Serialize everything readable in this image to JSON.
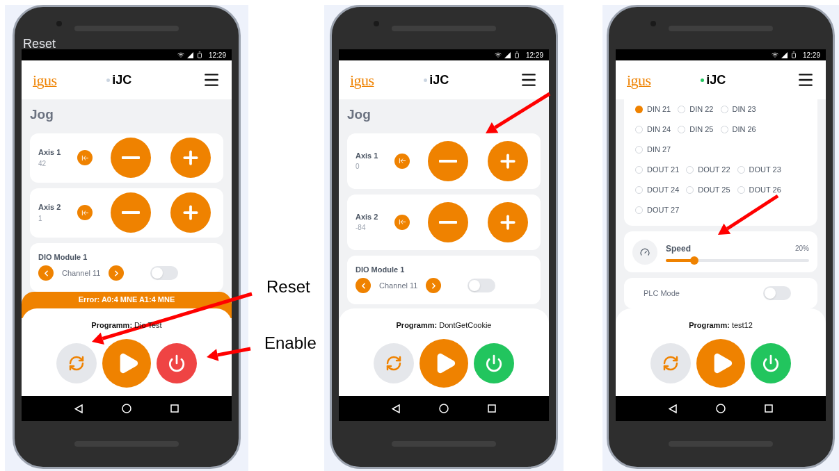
{
  "overlay_text": "Reset",
  "annotations": [
    {
      "text": "Reset"
    },
    {
      "text": "Enable"
    }
  ],
  "phones": [
    {
      "time": "12:29",
      "logo": "igus",
      "app_title": "iJC",
      "connected": false,
      "page_title": "Jog",
      "cards": [
        {
          "kind": "axis",
          "label": "Axis 1",
          "value": "42"
        },
        {
          "kind": "axis",
          "label": "Axis 2",
          "value": "1"
        },
        {
          "kind": "dio",
          "label": "DIO Module 1",
          "channel": "Channel 11",
          "on": false
        }
      ],
      "error": "Error: A0:4 MNE A1:4 MNE",
      "program": "**Programm:** Dio Test",
      "enabled": false
    },
    {
      "time": "12:29",
      "logo": "igus",
      "app_title": "iJC",
      "connected": false,
      "page_title": "Jog",
      "cards": [
        {
          "kind": "axis",
          "label": "Axis 1",
          "value": "0"
        },
        {
          "kind": "axis",
          "label": "Axis 2",
          "value": "-84"
        },
        {
          "kind": "dio",
          "label": "DIO Module 1",
          "channel": "Channel 11",
          "on": false
        }
      ],
      "program": "**Programm:** DontGetCookie",
      "enabled": true
    },
    {
      "time": "12:29",
      "logo": "igus",
      "app_title": "iJC",
      "connected": true,
      "cards": [
        {
          "kind": "radio_group",
          "rows": [
            [
              {
                "label": "DIN 21",
                "selected": true
              },
              {
                "label": "DIN 22",
                "selected": false
              },
              {
                "label": "DIN 23",
                "selected": false
              }
            ],
            [
              {
                "label": "DIN 24",
                "selected": false
              },
              {
                "label": "DIN 25",
                "selected": false
              },
              {
                "label": "DIN 26",
                "selected": false
              }
            ],
            [
              {
                "label": "DIN 27",
                "selected": false
              }
            ],
            [
              {
                "label": "DOUT 21",
                "selected": false
              },
              {
                "label": "DOUT 22",
                "selected": false
              },
              {
                "label": "DOUT 23",
                "selected": false
              }
            ],
            [
              {
                "label": "DOUT 24",
                "selected": false
              },
              {
                "label": "DOUT 25",
                "selected": false
              },
              {
                "label": "DOUT 26",
                "selected": false
              }
            ],
            [
              {
                "label": "DOUT 27",
                "selected": false
              }
            ]
          ]
        },
        {
          "kind": "speed",
          "label": "Speed",
          "reading": "20%",
          "level": 0.2
        },
        {
          "kind": "toggle",
          "label": "PLC Mode",
          "on": false
        }
      ],
      "program": "**Programm:** test12",
      "enabled": true
    }
  ]
}
